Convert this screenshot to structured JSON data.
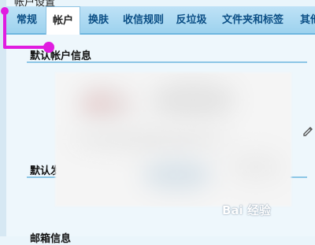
{
  "header": {
    "partial_title": "帐户设置"
  },
  "tabs": [
    {
      "label": "常规",
      "active": false
    },
    {
      "label": "帐户",
      "active": true
    },
    {
      "label": "换肤",
      "active": false
    },
    {
      "label": "收信规则",
      "active": false
    },
    {
      "label": "反垃圾",
      "active": false
    },
    {
      "label": "文件夹和标签",
      "active": false
    },
    {
      "label": "其他",
      "active": false
    }
  ],
  "sections": {
    "default_account_info": "默认帐户信息",
    "default_sender_partial": "默认发",
    "bottom_partial": "邮箱信息"
  },
  "watermark": {
    "text": "Bai 经验"
  },
  "colors": {
    "accent": "#9dd2ee",
    "tab_text": "#0a4e85",
    "annotation": "#e01ce0"
  }
}
